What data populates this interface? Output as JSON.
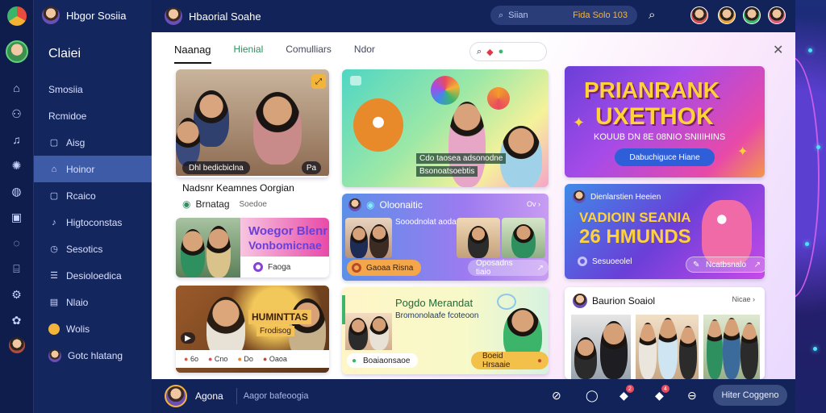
{
  "app": {
    "title": "Hbgor Sosiia"
  },
  "rail": {
    "icons": [
      "home-icon",
      "group-icon",
      "music-icon",
      "settings-icon",
      "globe-icon",
      "video-icon",
      "chat-icon",
      "shop-icon",
      "gear-icon",
      "badge-icon"
    ]
  },
  "sidebar": {
    "title": "Claiei",
    "items": [
      {
        "label": "Smosiia",
        "icon": "home-icon"
      },
      {
        "label": "Rcmidoe",
        "icon": "group-icon"
      },
      {
        "label": "Aisg",
        "icon": "box-icon"
      },
      {
        "label": "Hoinor",
        "icon": "home-icon",
        "active": true
      },
      {
        "label": "Rcaico",
        "icon": "box-icon"
      },
      {
        "label": "Higtoconstas",
        "icon": "music-icon"
      },
      {
        "label": "Sesotics",
        "icon": "clock-icon"
      },
      {
        "label": "Desioloedica",
        "icon": "list-icon"
      },
      {
        "label": "Nlaio",
        "icon": "chart-icon"
      },
      {
        "label": "Wolis",
        "icon": "dot-icon"
      },
      {
        "label": "Gotc hlatang",
        "icon": "avatar"
      }
    ]
  },
  "header": {
    "title": "Hbaorial Soahe",
    "search_placeholder": "Siian",
    "search_tag": "Fida Solo 103"
  },
  "main": {
    "tabs": [
      "Naanag",
      "Hienial",
      "Comulliars",
      "Ndor"
    ],
    "search_icons": [
      "search-icon",
      "heart-icon",
      "leaf-icon"
    ]
  },
  "cards": {
    "c1": {
      "title": "Nadsnr Keamnes Oorgian",
      "subtitle": "Brnatag",
      "meta": "Soedoe",
      "badge_left": "Dhl bedicbiclna",
      "badge_right": "Pa"
    },
    "c2": {
      "headline": "Woegor Blenr",
      "headline2": "Vonbomicnae",
      "button": "Faoga"
    },
    "c3": {
      "headline": "HUMINTTAS",
      "sub": "Frodisog",
      "bar_items": [
        "6o",
        "Cno",
        "Do",
        "Oaoa"
      ]
    },
    "c4": {
      "line1": "Cdo taosea adsonodne",
      "line2": "Bsonoatsoebtis"
    },
    "c5": {
      "title": "Oloonaitic",
      "sub": "Sooodnolat aodas",
      "meta": "Ov",
      "button_left": "Gaoaa Risna",
      "button_right": "Oposadns tiaio"
    },
    "c6": {
      "title": "Pogdo Merandat",
      "sub": "Bromonolaafe fcoteoon",
      "button_left": "Boaiaonsaoe",
      "button_right": "Boeid Hrsaaie"
    },
    "c7": {
      "line1": "PRIANRANK",
      "line2": "UXETHOK",
      "sub": "KOUUB DN 8E 08NIO SNIIIHINS",
      "button": "Dabuchiguce Hiane"
    },
    "c8": {
      "top": "Dienlarstien Heeien",
      "line1": "VADIOIN SEANIA",
      "line2": "26 HMUNDS",
      "tag": "Sesuoeolel",
      "button": "Ncatbsnalo"
    },
    "c9": {
      "title": "Baurion Soaiol",
      "meta": "Nicae"
    }
  },
  "footer": {
    "name": "Agona",
    "search_placeholder": "Aagor bafeoogia",
    "icons": [
      {
        "name": "compass-icon",
        "badge": ""
      },
      {
        "name": "location-icon",
        "badge": ""
      },
      {
        "name": "chat-icon",
        "badge": "2"
      },
      {
        "name": "notification-icon",
        "badge": "4"
      },
      {
        "name": "gauge-icon",
        "badge": ""
      }
    ],
    "button": "Hiter Coggeno"
  },
  "colors": {
    "accent_blue": "#3e5ba8",
    "accent_gold": "#f3b43b",
    "green": "#2e8f5f",
    "purple": "#6a3fd8",
    "pink": "#e84aa8"
  }
}
